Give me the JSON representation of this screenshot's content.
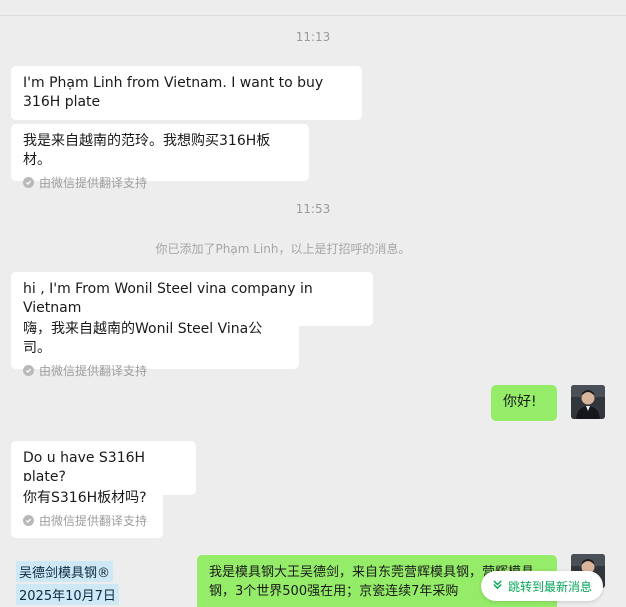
{
  "timestamps": [
    "11:13",
    "11:53"
  ],
  "system_notice": "你已添加了Phạm Linh，以上是打招呼的消息。",
  "translation_credit": "由微信提供翻译支持",
  "messages": [
    {
      "text": "I'm Phạm Linh from Vietnam. I want to buy 316H plate",
      "translation": "我是来自越南的范玲。我想购买316H板材。"
    },
    {
      "text": "hi , I'm From Wonil Steel vina company in Vietnam",
      "translation": "嗨，我来自越南的Wonil Steel Vina公司。"
    },
    {
      "text": "你好!"
    },
    {
      "text": "Do u have S316H plate?",
      "translation": "你有S316H板材吗?"
    },
    {
      "text": "我是模具钢大王吴德剑，来自东莞营辉模具钢，营辉模具钢，3个世界500强在用；京瓷连续7年采购"
    }
  ],
  "watermark": {
    "name": "吴德剑模具钢®",
    "date": "2025年10月7日"
  },
  "jump_button": {
    "label": "跳转到最新消息",
    "color": "#07a85a"
  },
  "colors": {
    "background": "#ededed",
    "incoming": "#ffffff",
    "outgoing": "#95ec69"
  },
  "icons": [
    "check-icon",
    "double-chevron-down-icon",
    "avatar"
  ]
}
